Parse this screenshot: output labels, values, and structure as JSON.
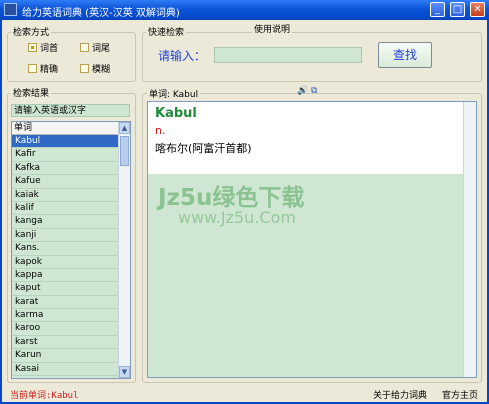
{
  "window": {
    "title": "给力英语词典 (英汉-汉英 双解词典)",
    "minimize_glyph": "_",
    "maximize_glyph": "□",
    "close_glyph": "✕"
  },
  "search_mode": {
    "title": "检索方式",
    "options": [
      {
        "label": "词首",
        "checked": true
      },
      {
        "label": "词尾",
        "checked": false
      },
      {
        "label": "精确",
        "checked": false
      },
      {
        "label": "模糊",
        "checked": false
      }
    ]
  },
  "quick_search": {
    "title": "快速检索",
    "usage_label": "使用说明",
    "input_label": "请输入：",
    "input_value": "",
    "button_label": "查找"
  },
  "results": {
    "title": "检索结果",
    "filter_placeholder": "请输入英语或汉字",
    "column_header": "单词",
    "words": [
      "Kabul",
      "Kafir",
      "Kafka",
      "Kafue",
      "kaiak",
      "kalif",
      "kanga",
      "kanji",
      "Kans.",
      "kapok",
      "kappa",
      "kaput",
      "karat",
      "karma",
      "karoo",
      "karst",
      "Karun",
      "Kasai"
    ],
    "selected_index": 0
  },
  "definition": {
    "word_label": "单词: Kabul",
    "speak_icon": "speaker-icon",
    "copy_icon": "copy-icon",
    "headword": "Kabul",
    "part_of_speech": "n.",
    "meaning": "喀布尔(阿富汗首都)",
    "watermark_main": "Jz5u绿色下载",
    "watermark_sub": "www.Jz5u.Com"
  },
  "status": {
    "current_word": "当前单词:Kabul",
    "about_link": "关于给力词典",
    "home_link": "官方主页"
  },
  "colors": {
    "titlebar": "#0a53d6",
    "panel_green": "#cfe7d2",
    "selection": "#3169c6",
    "headword": "#1e8a3a",
    "pos_red": "#d21e1e",
    "link_blue": "#1f3fd6"
  }
}
